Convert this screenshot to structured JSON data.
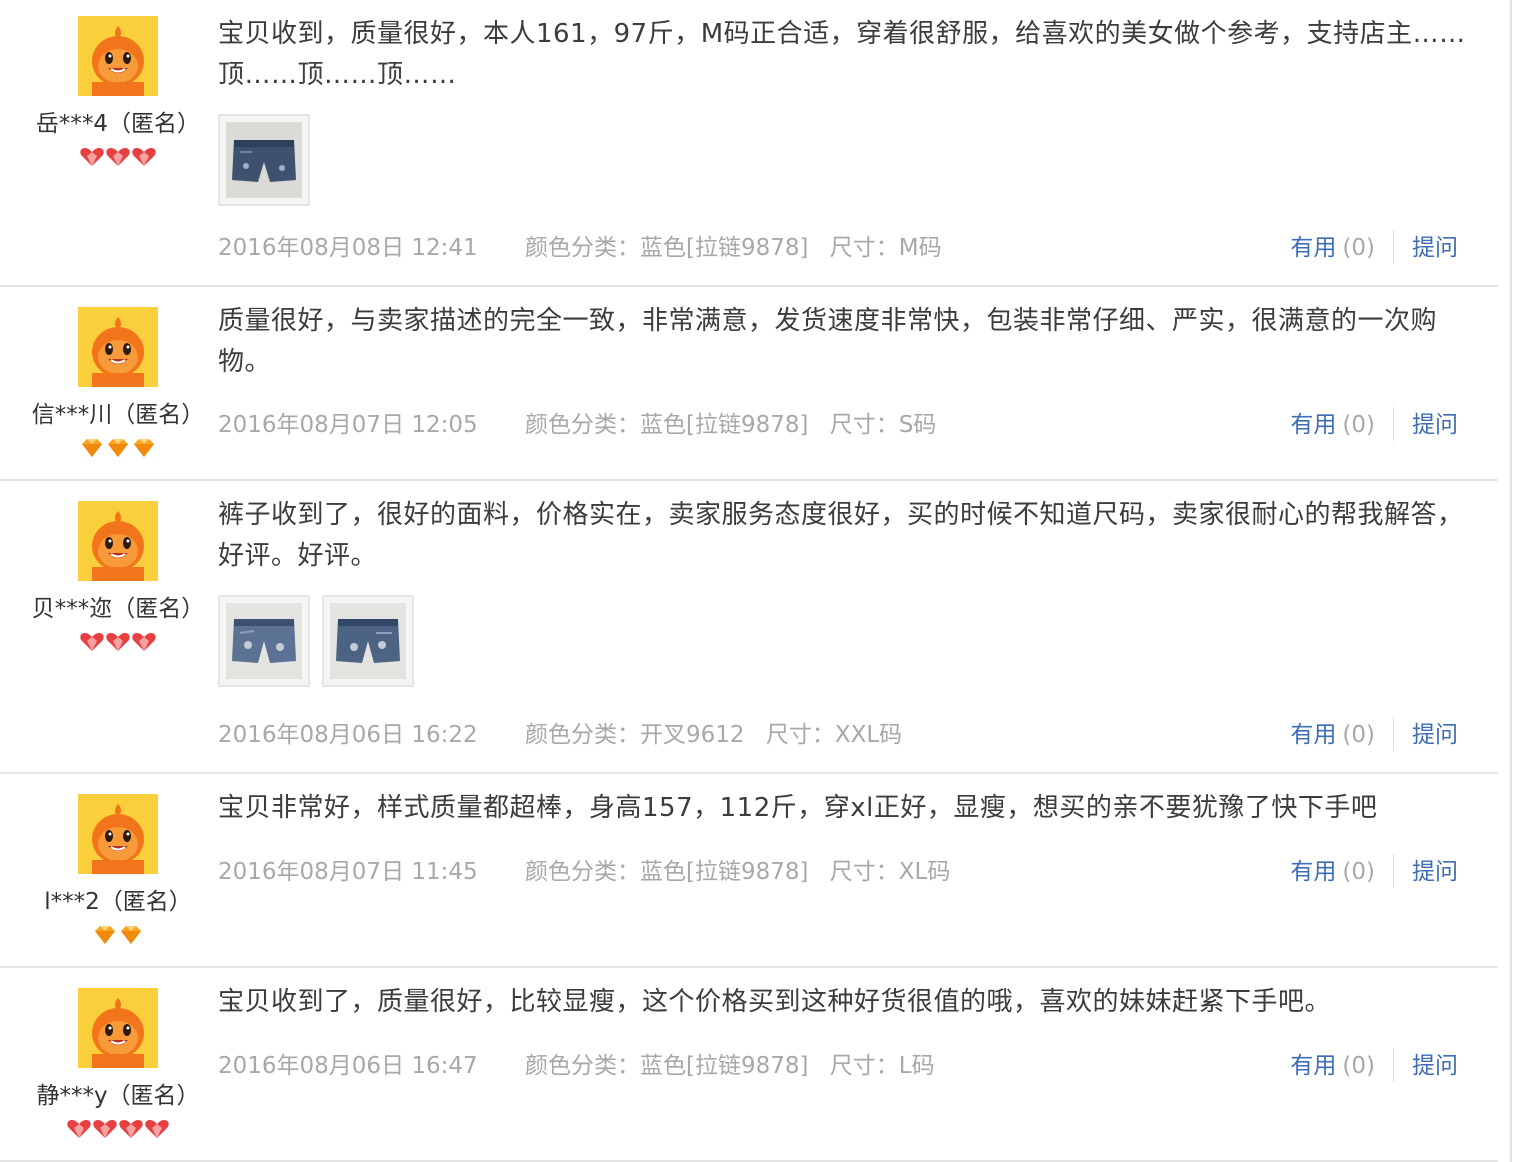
{
  "actions": {
    "useful_label": "有用",
    "ask_label": "提问"
  },
  "colors": {
    "link": "#3d6db5",
    "meta": "#a8a8a8",
    "text": "#3c3c3c",
    "heart": "#e84040",
    "diamond": "#f6a623"
  },
  "reviews": [
    {
      "user": "岳***4（匿名）",
      "level_icon": "red-heart-icon",
      "level_count": 3,
      "text": "宝贝收到，质量很好，本人161，97斤，M码正合适，穿着很舒服，给喜欢的美女做个参考，支持店主……顶……顶……顶……",
      "photos": [
        "denim-shorts-photo"
      ],
      "date": "2016年08月08日 12:41",
      "color_spec": "颜色分类：蓝色[拉链9878]",
      "size_spec": "尺寸：M码",
      "useful_count": "(0)"
    },
    {
      "user": "信***川（匿名）",
      "level_icon": "diamond-icon",
      "level_count": 3,
      "text": "质量很好，与卖家描述的完全一致，非常满意，发货速度非常快，包装非常仔细、严实，很满意的一次购物。",
      "photos": [],
      "date": "2016年08月07日 12:05",
      "color_spec": "颜色分类：蓝色[拉链9878]",
      "size_spec": "尺寸：S码",
      "useful_count": "(0)"
    },
    {
      "user": "贝***迩（匿名）",
      "level_icon": "red-heart-icon",
      "level_count": 3,
      "text": "裤子收到了，很好的面料，价格实在，卖家服务态度很好，买的时候不知道尺码，卖家很耐心的帮我解答，好评。好评。",
      "photos": [
        "denim-shorts-photo",
        "denim-shorts-photo"
      ],
      "date": "2016年08月06日 16:22",
      "color_spec": "颜色分类：开叉9612",
      "size_spec": "尺寸：XXL码",
      "useful_count": "(0)"
    },
    {
      "user": "l***2（匿名）",
      "level_icon": "diamond-icon",
      "level_count": 2,
      "text": "宝贝非常好，样式质量都超棒，身高157，112斤，穿xl正好，显瘦，想买的亲不要犹豫了快下手吧",
      "photos": [],
      "date": "2016年08月07日 11:45",
      "color_spec": "颜色分类：蓝色[拉链9878]",
      "size_spec": "尺寸：XL码",
      "useful_count": "(0)"
    },
    {
      "user": "静***y（匿名）",
      "level_icon": "red-heart-icon",
      "level_count": 4,
      "text": "宝贝收到了，质量很好，比较显瘦，这个价格买到这种好货很值的哦，喜欢的妹妹赶紧下手吧。",
      "photos": [],
      "date": "2016年08月06日 16:47",
      "color_spec": "颜色分类：蓝色[拉链9878]",
      "size_spec": "尺寸：L码",
      "useful_count": "(0)"
    }
  ]
}
